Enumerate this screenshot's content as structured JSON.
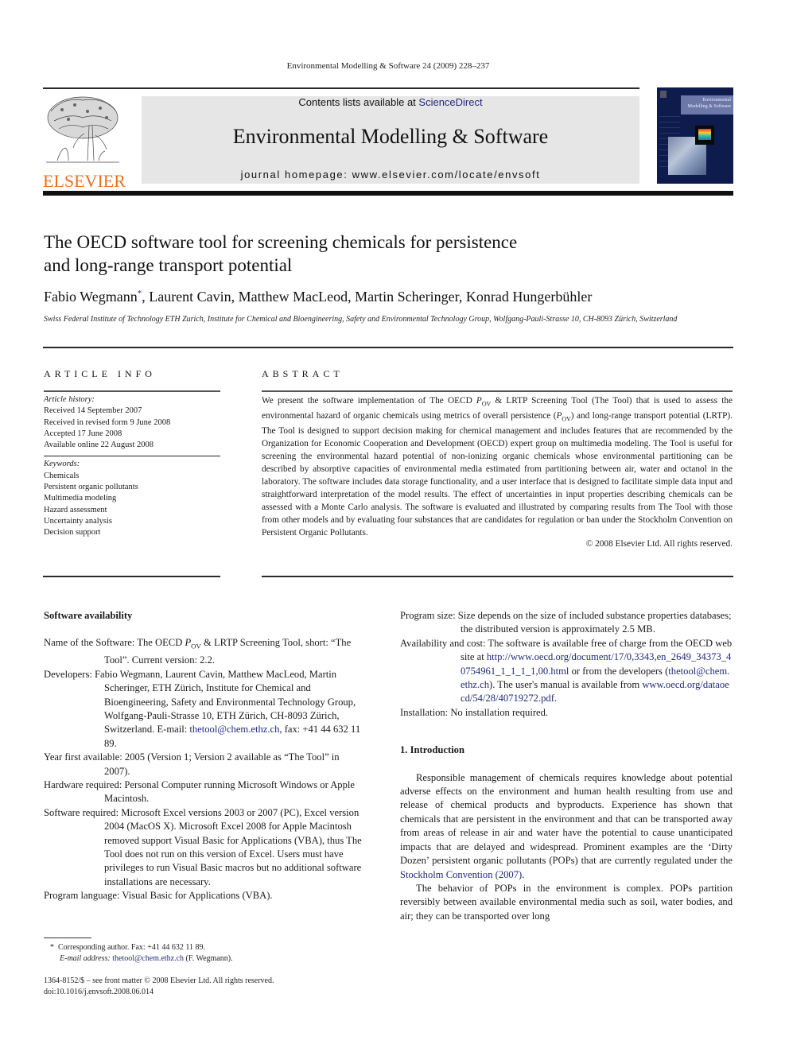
{
  "running_head": "Environmental Modelling & Software 24 (2009) 228–237",
  "masthead": {
    "publisher_logo_text": "ELSEVIER",
    "contents_prefix": "Contents lists available at ",
    "contents_link": "ScienceDirect",
    "journal_title": "Environmental Modelling & Software",
    "homepage": "journal homepage: www.elsevier.com/locate/envsoft",
    "cover_title": "Environmental Modelling & Software",
    "colors": {
      "banner_bg": "#e6e6e6",
      "elsevier_orange": "#e8711f",
      "link_blue": "#1f2a7a",
      "cover_navy": "#0e1b4d"
    }
  },
  "article": {
    "title_line1": "The OECD software tool for screening chemicals for persistence",
    "title_line2": "and long-range transport potential",
    "authors": [
      "Fabio Wegmann",
      "Laurent Cavin",
      "Matthew MacLeod",
      "Martin Scheringer",
      "Konrad Hungerbühler"
    ],
    "corresponding_mark": "*",
    "affiliation": "Swiss Federal Institute of Technology ETH Zurich, Institute for Chemical and Bioengineering, Safety and Environmental Technology Group, Wolfgang-Pauli-Strasse 10, CH-8093 Zürich, Switzerland"
  },
  "article_info": {
    "heading": "ARTICLE INFO",
    "history_label": "Article history:",
    "history": [
      "Received 14 September 2007",
      "Received in revised form 9 June 2008",
      "Accepted 17 June 2008",
      "Available online 22 August 2008"
    ],
    "keywords_label": "Keywords:",
    "keywords": [
      "Chemicals",
      "Persistent organic pollutants",
      "Multimedia modeling",
      "Hazard assessment",
      "Uncertainty analysis",
      "Decision support"
    ]
  },
  "abstract": {
    "heading": "ABSTRACT",
    "p1": "We present the software implementation of The OECD ",
    "p_ov": "P",
    "p_ov_sub": "OV",
    "p2": " & LRTP Screening Tool (The Tool) that is used to assess the environmental hazard of organic chemicals using metrics of overall persistence (",
    "p3": ") and long-range transport potential (LRTP). The Tool is designed to support decision making for chemical management and includes features that are recommended by the Organization for Economic Cooperation and Development (OECD) expert group on multimedia modeling. The Tool is useful for screening the environmental hazard potential of non-ionizing organic chemicals whose environmental partitioning can be described by absorptive capacities of environmental media estimated from partitioning between air, water and octanol in the laboratory. The software includes data storage functionality, and a user interface that is designed to facilitate simple data input and straightforward interpretation of the model results. The effect of uncertainties in input properties describing chemicals can be assessed with a Monte Carlo analysis. The software is evaluated and illustrated by comparing results from The Tool with those from other models and by evaluating four substances that are candidates for regulation or ban under the Stockholm Convention on Persistent Organic Pollutants.",
    "copyright": "© 2008 Elsevier Ltd. All rights reserved."
  },
  "software_availability": {
    "heading": "Software availability",
    "name_label": "Name of the Software: ",
    "name_a": "The OECD ",
    "name_b": " & LRTP Screening Tool, short: “The Tool”. Current version: 2.2.",
    "developers_label": "Developers: ",
    "developers_text": "Fabio Wegmann, Laurent Cavin, Matthew MacLeod, Martin Scheringer, ETH Zürich, Institute for Chemical and Bioengineering, Safety and Environmental Technology Group, Wolfgang-Pauli-Strasse 10, ETH Zürich, CH-8093 Zürich, Switzerland. E-mail: ",
    "developers_email": "thetool@chem.ethz.ch",
    "developers_fax": ", fax: +41 44 632 11 89.",
    "year_label": "Year first available: ",
    "year_text": "2005 (Version 1; Version 2 available as “The Tool” in 2007).",
    "hardware_label": "Hardware required: ",
    "hardware_text": "Personal Computer running Microsoft Windows or Apple Macintosh.",
    "software_label": "Software required: ",
    "software_text": "Microsoft Excel versions 2003 or 2007 (PC), Excel version 2004 (MacOS X). Microsoft Excel 2008 for Apple Macintosh removed support Visual Basic for Applications (VBA), thus The Tool does not run on this version of Excel. Users must have privileges to run Visual Basic macros but no additional software installations are necessary.",
    "language_label": "Program language: ",
    "language_text": "Visual Basic for Applications (VBA).",
    "size_label": "Program size: ",
    "size_text": "Size depends on the size of included substance properties databases; the distributed version is approximately 2.5 MB.",
    "availability_label": "Availability and cost: ",
    "availability_text": "The software is available free of charge from the OECD website at ",
    "availability_url": "http://www.oecd.org/document/17/0,3343,en_2649_34373_40754961_1_1_1_1,00.html",
    "availability_mid": " or from the developers (",
    "availability_email": "thetool@chem.ethz.ch",
    "availability_manual": "). The user's manual is available from ",
    "manual_url": "www.oecd.org/dataoecd/54/28/40719272.pdf",
    "manual_end": ".",
    "installation_label": "Installation: ",
    "installation_text": "No installation required."
  },
  "introduction": {
    "heading": "1.  Introduction",
    "p1_a": "Responsible management of chemicals requires knowledge about potential adverse effects on the environment and human health resulting from use and release of chemical products and byproducts. Experience has shown that chemicals that are persistent in the environment and that can be transported away from areas of release in air and water have the potential to cause unanticipated impacts that are delayed and widespread. Prominent examples are the ‘Dirty Dozen’ persistent organic pollutants (POPs) that are currently regulated under the ",
    "p1_link": "Stockholm Convention (2007)",
    "p1_end": ".",
    "p2": "The behavior of POPs in the environment is complex. POPs partition reversibly between available environmental media such as soil, water bodies, and air; they can be transported over long"
  },
  "footnote": {
    "mark": "*",
    "corresponding": "Corresponding author. Fax: +41 44 632 11 89.",
    "email_label": "E-mail address: ",
    "email": "thetool@chem.ethz.ch",
    "email_name": " (F. Wegmann).",
    "front_matter": "1364-8152/$ – see front matter © 2008 Elsevier Ltd. All rights reserved.",
    "doi": "doi:10.1016/j.envsoft.2008.06.014"
  }
}
